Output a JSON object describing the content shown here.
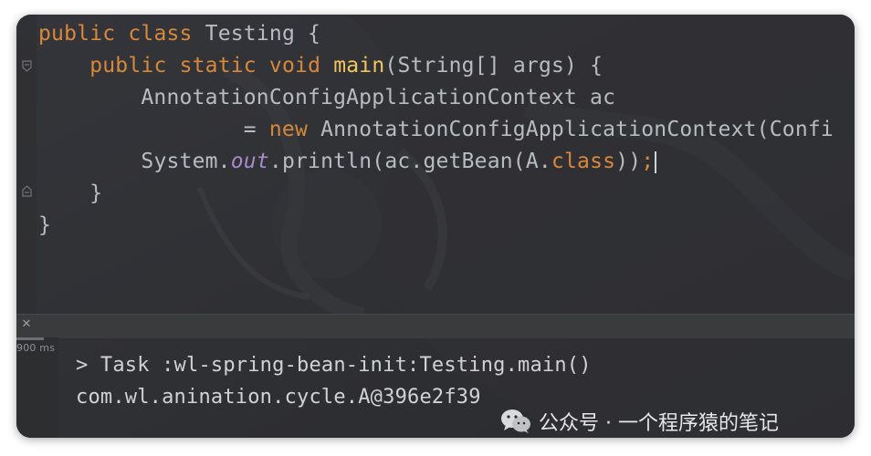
{
  "editor": {
    "lines": [
      {
        "indent": "",
        "t1": "public",
        "t2": " ",
        "t3": "class",
        "t4": " Testing {"
      },
      {
        "indent": "    ",
        "t1": "public",
        "t2": " ",
        "t3": "static",
        "t4": " ",
        "t5": "void",
        "t6": " ",
        "t7": "main",
        "t8": "(String[] args) {"
      },
      {
        "text": "        AnnotationConfigApplicationContext ac"
      },
      {
        "indent": "                ",
        "t1": "= ",
        "t2": "new",
        "t3": " AnnotationConfigApplicationContext(Confi"
      },
      {
        "indent": "        ",
        "t1": "System.",
        "t2": "out",
        "t3": ".println(ac.getBean(A.",
        "t4": "class",
        "t5": "))",
        "t6": ";"
      },
      {
        "text": "    }"
      },
      {
        "text": "}"
      }
    ]
  },
  "run_panel": {
    "close_icon": "close-icon",
    "duration": "900 ms",
    "task_line": "> Task :wl-spring-bean-init:Testing.main()",
    "output_line": "com.wl.anination.cycle.A@396e2f39"
  },
  "watermark": {
    "icon": "wechat-icon",
    "text": "公众号 · 一个程序猿的笔记"
  },
  "colors": {
    "keyword": "#d7883b",
    "method": "#f2c55c",
    "static_field": "#a68ac9",
    "text": "#b7bcc3",
    "background": "#2a2b2d"
  }
}
